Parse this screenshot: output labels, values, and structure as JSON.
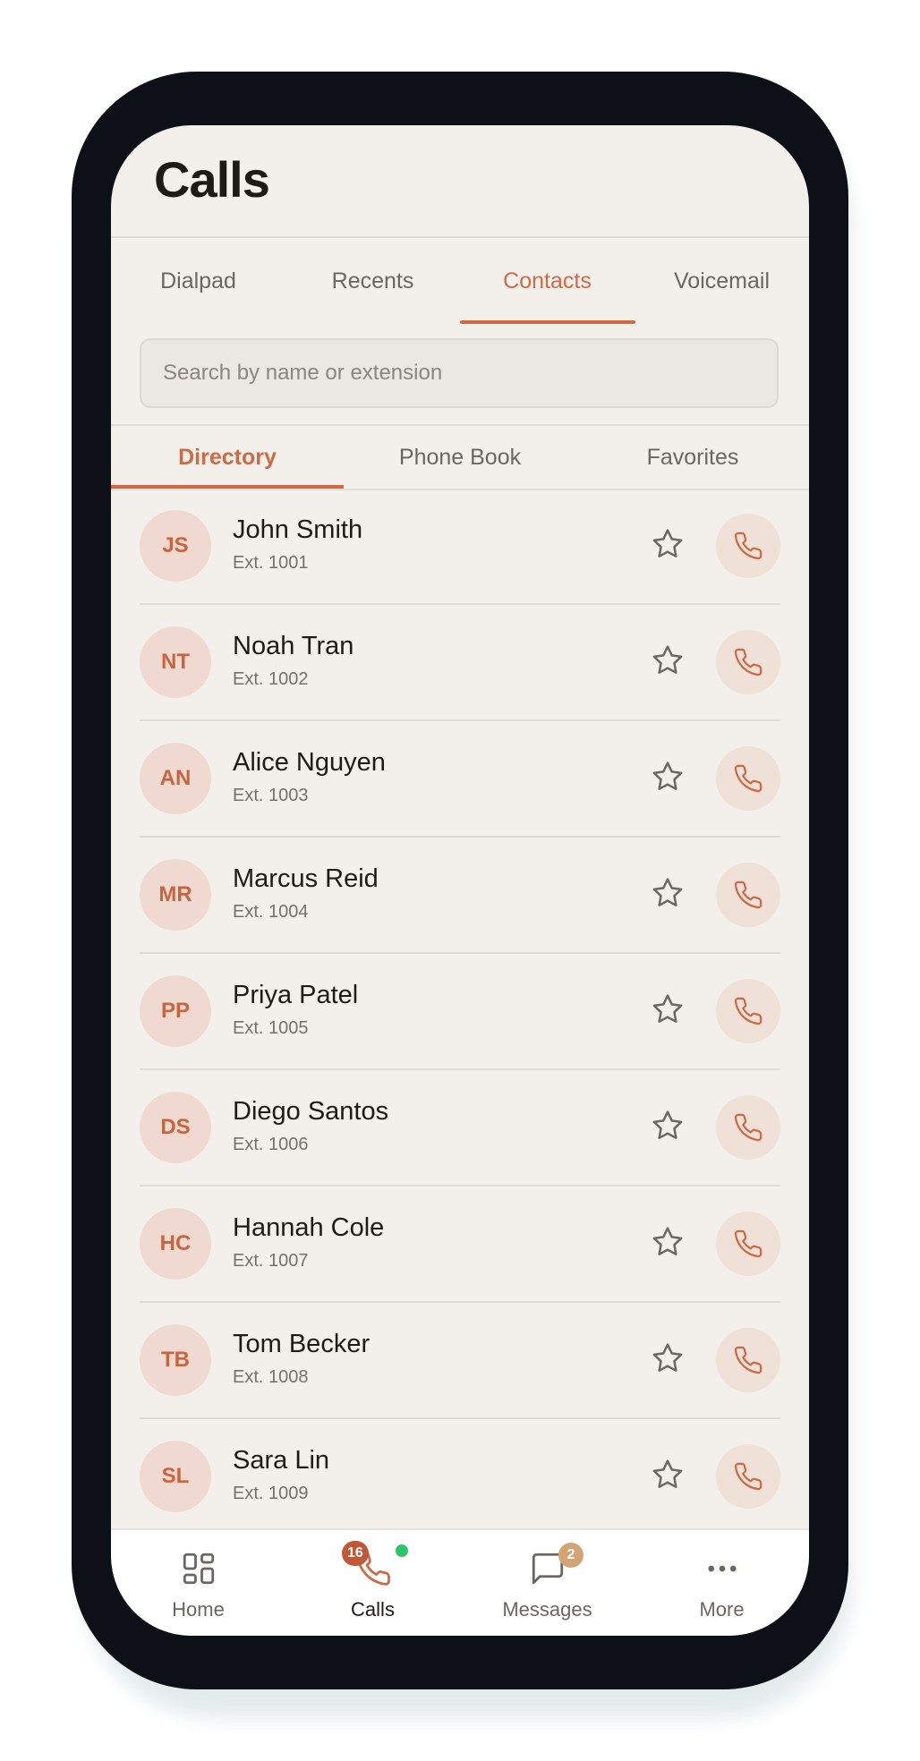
{
  "header": {
    "title": "Calls"
  },
  "tabs": [
    "Dialpad",
    "Recents",
    "Contacts",
    "Voicemail"
  ],
  "active_tab": "Contacts",
  "search": {
    "placeholder": "Search by name or extension"
  },
  "subtabs": [
    "Directory",
    "Phone Book",
    "Favorites"
  ],
  "active_subtab": "Directory",
  "contacts": [
    {
      "initials": "JS",
      "name": "John Smith",
      "ext": "Ext. 1001"
    },
    {
      "initials": "NT",
      "name": "Noah Tran",
      "ext": "Ext. 1002"
    },
    {
      "initials": "AN",
      "name": "Alice Nguyen",
      "ext": "Ext. 1003"
    },
    {
      "initials": "MR",
      "name": "Marcus Reid",
      "ext": "Ext. 1004"
    },
    {
      "initials": "PP",
      "name": "Priya Patel",
      "ext": "Ext. 1005"
    },
    {
      "initials": "DS",
      "name": "Diego Santos",
      "ext": "Ext. 1006"
    },
    {
      "initials": "HC",
      "name": "Hannah Cole",
      "ext": "Ext. 1007"
    },
    {
      "initials": "TB",
      "name": "Tom Becker",
      "ext": "Ext. 1008"
    },
    {
      "initials": "SL",
      "name": "Sara Lin",
      "ext": "Ext. 1009"
    }
  ],
  "bottom_nav": [
    {
      "label": "Home",
      "icon": "grid-icon"
    },
    {
      "label": "Calls",
      "icon": "phone-icon",
      "badge": "16"
    },
    {
      "label": "Messages",
      "icon": "chat-icon",
      "badge": "2"
    },
    {
      "label": "More",
      "icon": "more-icon"
    }
  ],
  "colors": {
    "accent": "#cf6a45",
    "calls_badge": "#c0583a",
    "messages_badge": "#d4a574",
    "presence_dot": "#2ec56a"
  }
}
